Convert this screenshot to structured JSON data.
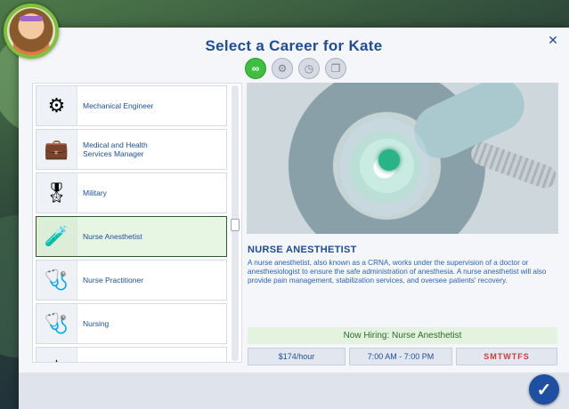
{
  "dialog": {
    "title": "Select a Career for Kate",
    "close_icon": "close-icon",
    "confirm_icon": "checkmark-icon"
  },
  "tabs": [
    {
      "icon": "infinity-icon",
      "glyph": "∞",
      "active": true
    },
    {
      "icon": "camera-part-time-icon",
      "glyph": "⚙",
      "active": false
    },
    {
      "icon": "clock-part-time-icon",
      "glyph": "◷",
      "active": false
    },
    {
      "icon": "folders-icon",
      "glyph": "❐",
      "active": false
    }
  ],
  "careers": [
    {
      "label": "Mechanical Engineer",
      "icon": "gears-icon",
      "glyph": "⚙",
      "selected": false
    },
    {
      "label": "Medical and Health\nServices Manager",
      "icon": "briefcase-icon",
      "glyph": "💼",
      "selected": false
    },
    {
      "label": "Military",
      "icon": "military-chevron-icon",
      "glyph": "🎖",
      "selected": false
    },
    {
      "label": "Nurse Anesthetist",
      "icon": "pink-vial-icon",
      "glyph": "🧪",
      "selected": true
    },
    {
      "label": "Nurse Practitioner",
      "icon": "stethoscope-icon",
      "glyph": "🩺",
      "selected": false
    },
    {
      "label": "Nursing",
      "icon": "stethoscope-icon",
      "glyph": "🩺",
      "selected": false
    },
    {
      "label": "",
      "icon": "partial-icon",
      "glyph": "★",
      "selected": false
    }
  ],
  "detail": {
    "name": "Nurse Anesthetist",
    "description": "A nurse anesthetist, also known as a CRNA, works under the supervision of a doctor or anesthesiologist to ensure the safe administration of anesthesia. A nurse anesthetist will also provide pain management, stabilization services, and oversee patients' recovery.",
    "hiring": "Now Hiring: Nurse Anesthetist",
    "pay": "$174/hour",
    "hours": "7:00 AM - 7:00 PM",
    "days": [
      "S",
      "M",
      "T",
      "W",
      "T",
      "F",
      "S"
    ]
  },
  "colors": {
    "accent": "#1d4d9a",
    "hiring_bg": "#e4f3df",
    "days": "#d33a3a"
  }
}
